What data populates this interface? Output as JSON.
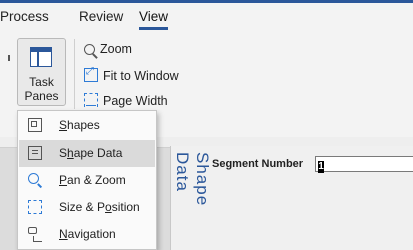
{
  "tabs": [
    {
      "label": "Process"
    },
    {
      "label": "Review"
    },
    {
      "label": "View",
      "active": true
    }
  ],
  "ribbon": {
    "task_panes": {
      "line1": "Task",
      "line2": "Panes ⌄"
    },
    "zoom": {
      "label": "Zoom",
      "icon": "zoom-icon"
    },
    "fit_to_window": {
      "label": "Fit to Window",
      "icon": "fit-to-window-icon"
    },
    "page_width": {
      "label": "Page Width",
      "icon": "page-width-icon"
    }
  },
  "menu": {
    "items": [
      {
        "label_pre": "",
        "accel": "S",
        "label_post": "hapes",
        "icon": "shapes-icon"
      },
      {
        "label_pre": "S",
        "accel": "h",
        "label_post": "ape Data",
        "icon": "shape-data-icon",
        "highlighted": true
      },
      {
        "label_pre": "",
        "accel": "P",
        "label_post": "an & Zoom",
        "icon": "pan-zoom-icon"
      },
      {
        "label_pre": "Size & P",
        "accel": "o",
        "label_post": "sition",
        "icon": "size-position-icon"
      },
      {
        "label_pre": "",
        "accel": "N",
        "label_post": "avigation",
        "icon": "navigation-icon"
      }
    ]
  },
  "shape_data_panel": {
    "title": "Shape Data",
    "field_label": "Segment Number",
    "field_value": "1"
  },
  "colors": {
    "accent": "#2b579a",
    "ribbon_bg": "#f3f3f3",
    "menu_highlight": "#dadada"
  }
}
